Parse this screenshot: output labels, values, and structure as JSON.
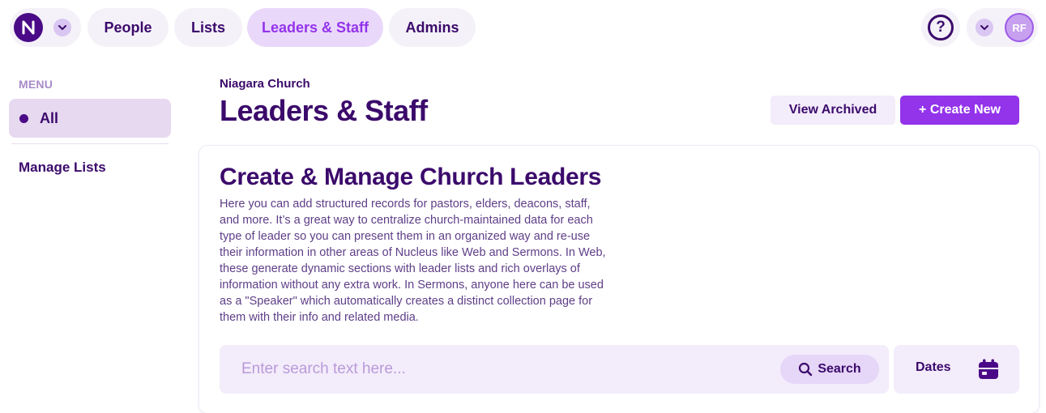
{
  "nav": {
    "tabs": [
      {
        "label": "People"
      },
      {
        "label": "Lists"
      },
      {
        "label": "Leaders & Staff"
      },
      {
        "label": "Admins"
      }
    ],
    "active_tab": "Leaders & Staff",
    "help_label": "?",
    "avatar_initials": "RF"
  },
  "sidebar": {
    "heading": "MENU",
    "items": [
      {
        "label": "All"
      }
    ],
    "manage_label": "Manage Lists"
  },
  "header": {
    "org_name": "Niagara Church",
    "title": "Leaders & Staff",
    "view_archived_label": "View Archived",
    "create_label": "+ Create New"
  },
  "card": {
    "title": "Create & Manage Church Leaders",
    "description": "Here you can add structured records for pastors, elders, deacons, staff, and more. It’s a great way to centralize church-maintained data for each type of leader so you can present them in an organized way and re-use their information in other areas of Nucleus like Web and Sermons. In Web, these generate dynamic sections with leader lists and rich overlays of information without any extra work. In Sermons, anyone here can be used as a \"Speaker\" which automatically creates a distinct collection page for them with their info and related media."
  },
  "search": {
    "placeholder": "Enter search text here...",
    "button_label": "Search",
    "dates_label": "Dates"
  },
  "colors": {
    "brand": "#4a0a87",
    "accent": "#9333ea",
    "text": "#3b0a6b",
    "pill_bg": "#f4f1f8"
  }
}
